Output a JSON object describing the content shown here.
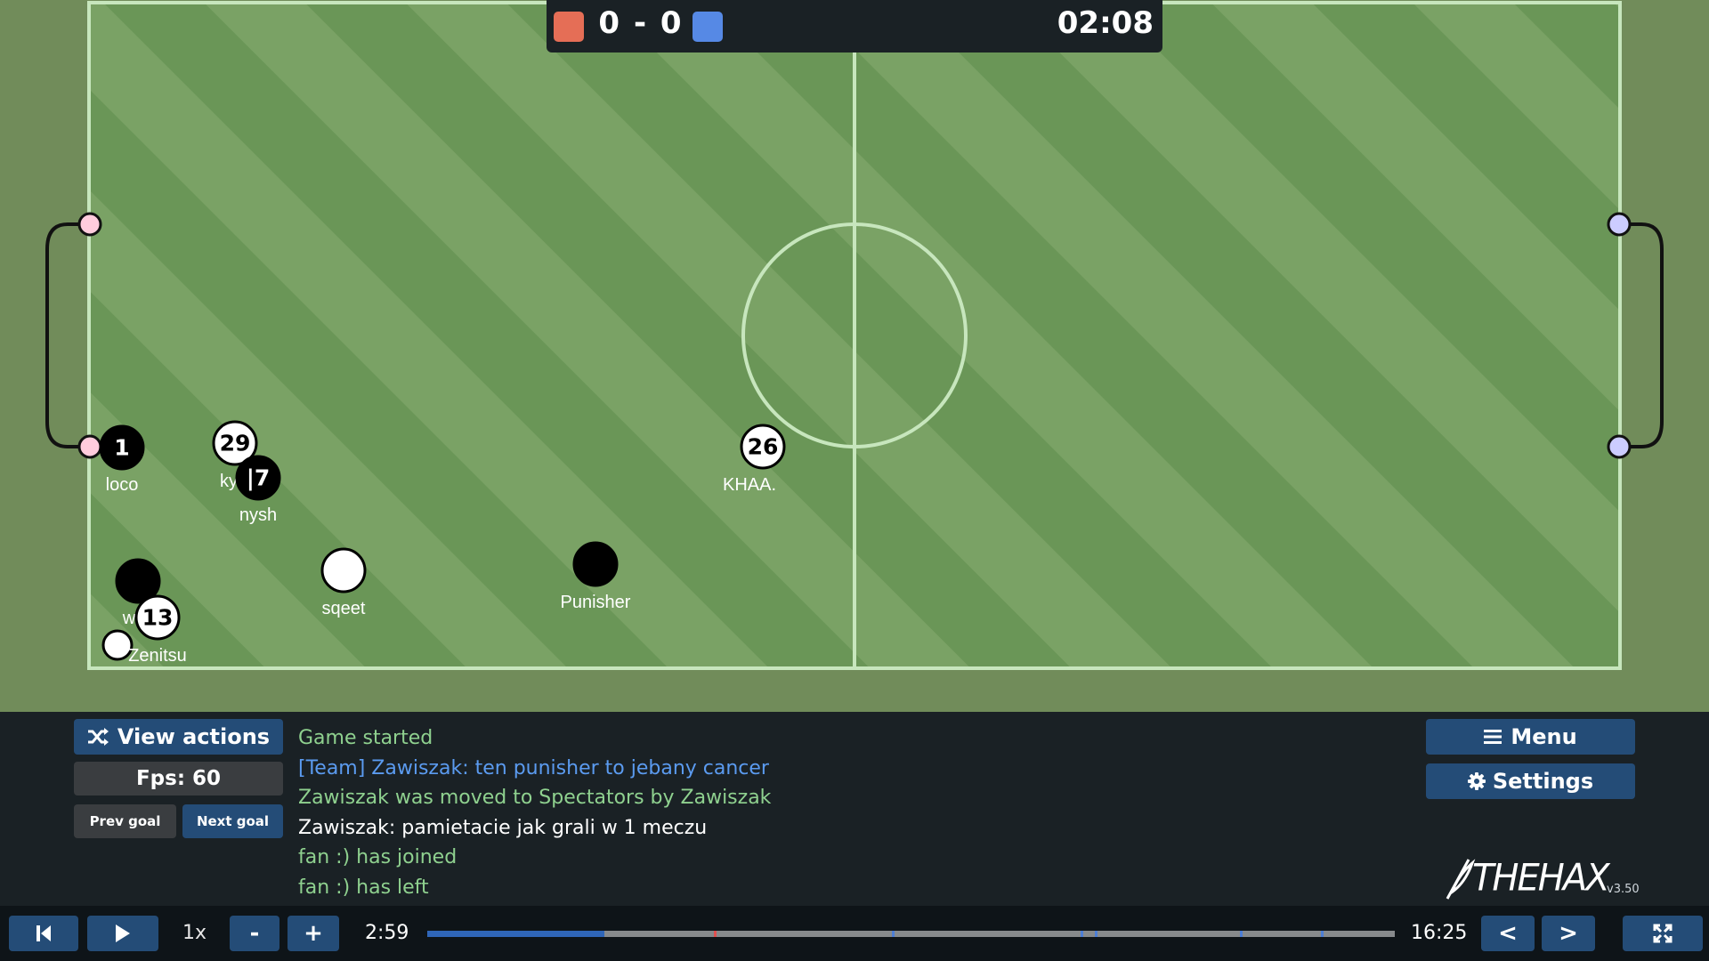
{
  "scoreboard": {
    "score_red": "0",
    "separator": "-",
    "score_blue": "0",
    "clock": "02:08",
    "red_color": "#e56e56",
    "blue_color": "#5689e5"
  },
  "field": {
    "grass_light": "#7aa265",
    "grass_dark": "#6a9657",
    "line_color": "#c7e6bd",
    "red_post_color": "#ffccdd",
    "blue_post_color": "#ccccff"
  },
  "players": [
    {
      "number": "1",
      "name": "loco",
      "team": "black"
    },
    {
      "number": "29",
      "name": "ky",
      "team": "white"
    },
    {
      "number": "|7",
      "name": "nysh",
      "team": "black"
    },
    {
      "number": "26",
      "name": "KHAA.",
      "team": "white"
    },
    {
      "number": "",
      "name": "sqeet",
      "team": "white"
    },
    {
      "number": "",
      "name": "Punisher",
      "team": "black"
    },
    {
      "number": "",
      "name": "w",
      "team": "black"
    },
    {
      "number": "13",
      "name": "",
      "team": "white"
    },
    {
      "number": "",
      "name": "Zenitsu",
      "team": "white"
    }
  ],
  "side_buttons": {
    "view_actions": "View actions",
    "fps": "Fps: 60",
    "prev_goal": "Prev goal",
    "next_goal": "Next goal",
    "menu": "Menu",
    "settings": "Settings"
  },
  "chat": [
    {
      "text": "Game started",
      "style": "green"
    },
    {
      "text": "[Team] Zawiszak: ten punisher to jebany cancer",
      "style": "blue"
    },
    {
      "text": "Zawiszak was moved to Spectators by Zawiszak",
      "style": "green"
    },
    {
      "text": "Zawiszak: pamietacie jak grali w 1 meczu",
      "style": "white"
    },
    {
      "text": "fan :) has joined",
      "style": "green"
    },
    {
      "text": "fan :) has left",
      "style": "green"
    }
  ],
  "logo": {
    "text": "THEHAX",
    "version": "v3.50"
  },
  "playback": {
    "speed": "1x",
    "minus": "-",
    "plus": "+",
    "current_time": "2:59",
    "total_time": "16:25",
    "prev": "<",
    "next": ">",
    "progress": 0.183,
    "event_marks": [
      {
        "at": 0.296,
        "color": "#e05050"
      },
      {
        "at": 0.48,
        "color": "#4d7fd6"
      },
      {
        "at": 0.675,
        "color": "#4d7fd6"
      },
      {
        "at": 0.69,
        "color": "#4d7fd6"
      },
      {
        "at": 0.84,
        "color": "#4d7fd6"
      },
      {
        "at": 0.924,
        "color": "#4d7fd6"
      }
    ]
  }
}
